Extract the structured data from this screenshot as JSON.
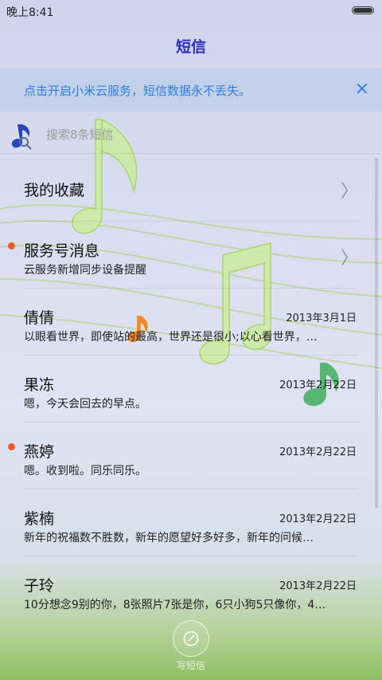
{
  "status": {
    "time": "晚上8:41"
  },
  "header": {
    "title": "短信"
  },
  "banner": {
    "text": "点击开启小米云服务，短信数据永不丢失。",
    "close_icon": "×"
  },
  "search": {
    "placeholder": "搜索8条短信"
  },
  "conversations": [
    {
      "name": "我的收藏",
      "preview": "",
      "date": "",
      "unread": false,
      "chevron": "〉"
    },
    {
      "name": "服务号消息",
      "preview": "云服务新增同步设备提醒",
      "date": "",
      "unread": true,
      "chevron": "〉"
    },
    {
      "name": "倩倩",
      "preview": "以眼看世界，即使站的最高，世界还是很小;以心看世界，…",
      "date": "2013年3月1日",
      "unread": false
    },
    {
      "name": "果冻",
      "preview": "嗯，今天会回去的早点。",
      "date": "2013年2月22日",
      "unread": false
    },
    {
      "name": "燕婷",
      "preview": "嗯。收到啦。同乐同乐。",
      "date": "2013年2月22日",
      "unread": true
    },
    {
      "name": "紫楠",
      "preview": "新年的祝福数不胜数，新年的愿望好多好多，新年的问候…",
      "date": "2013年2月22日",
      "unread": false
    },
    {
      "name": "子玲",
      "preview": "10分想念9别的你，8张照片7张是你，6只小狗5只像你，4…",
      "date": "2013年2月22日",
      "unread": false
    }
  ],
  "compose": {
    "label": "写短信",
    "icon": "compose-icon"
  },
  "colors": {
    "accent": "#2a7fe0",
    "title": "#2f2fc6",
    "unread_dot": "#f15a24"
  }
}
